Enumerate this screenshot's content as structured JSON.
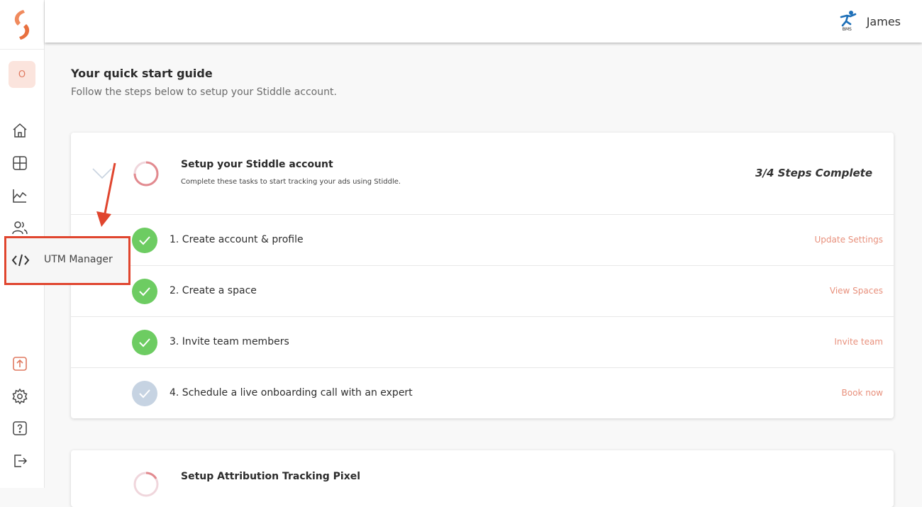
{
  "colors": {
    "accent": "#e8907c",
    "success": "#6dcc62",
    "pending": "#c6d3e2",
    "annotation": "#e0452e"
  },
  "sidebar": {
    "org_initial": "O",
    "items": [
      {
        "icon": "home-icon"
      },
      {
        "icon": "dashboard-grid-icon"
      },
      {
        "icon": "analytics-chart-icon"
      },
      {
        "icon": "users-icon"
      },
      {
        "icon": "code-icon",
        "label": "UTM Manager"
      },
      {
        "icon": "upload-icon"
      },
      {
        "icon": "gear-icon"
      },
      {
        "icon": "help-icon"
      },
      {
        "icon": "logout-icon"
      }
    ]
  },
  "header": {
    "user_name": "James",
    "avatar_caption": "BMS"
  },
  "guide": {
    "title": "Your quick start guide",
    "subtitle": "Follow the steps below to setup your Stiddle account."
  },
  "card1": {
    "title": "Setup your Stiddle account",
    "description": "Complete these tasks to start tracking your ads using Stiddle.",
    "progress_text": "3/4 Steps Complete",
    "progress_fraction": 0.75,
    "steps": [
      {
        "label": "1. Create account & profile",
        "action": "Update Settings",
        "done": true
      },
      {
        "label": "2. Create a space",
        "action": "View Spaces",
        "done": true
      },
      {
        "label": "3. Invite team members",
        "action": "Invite team",
        "done": true
      },
      {
        "label": "4. Schedule a live onboarding call with an expert",
        "action": "Book now",
        "done": false
      }
    ]
  },
  "card2": {
    "title": "Setup Attribution Tracking Pixel"
  },
  "tooltip": {
    "label": "UTM Manager"
  }
}
